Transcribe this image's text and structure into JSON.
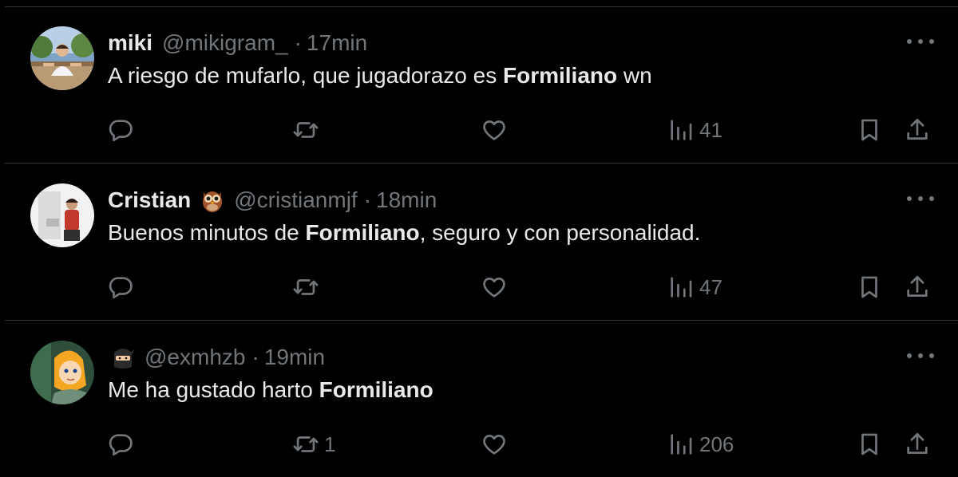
{
  "tweets": [
    {
      "name": "miki",
      "emoji": "",
      "handle": "@mikigram_",
      "separator": "·",
      "time": "17min",
      "text_before": "A riesgo de mufarlo, que jugadorazo es ",
      "text_bold": "Formiliano",
      "text_after": " wn",
      "replies": "",
      "retweets": "",
      "likes": "",
      "views": "41",
      "avatar_icon": "avatar-photo-outdoor"
    },
    {
      "name": "Cristian",
      "emoji": "owl-emoji",
      "handle": "@cristianmjf",
      "separator": "·",
      "time": "18min",
      "text_before": "Buenos minutos de ",
      "text_bold": "Formiliano",
      "text_after": ", seguro y con personalidad.",
      "replies": "",
      "retweets": "",
      "likes": "",
      "views": "47",
      "avatar_icon": "avatar-photo-person"
    },
    {
      "name": "",
      "emoji": "ninja-emoji",
      "handle": "@exmhzb",
      "separator": "·",
      "time": "19min",
      "text_before": "Me ha gustado harto ",
      "text_bold": "Formiliano",
      "text_after": "",
      "replies": "",
      "retweets": "1",
      "likes": "",
      "views": "206",
      "avatar_icon": "avatar-anime-character"
    }
  ],
  "icons": {
    "reply": "reply-icon",
    "retweet": "retweet-icon",
    "like": "heart-icon",
    "views": "views-icon",
    "bookmark": "bookmark-icon",
    "share": "share-icon",
    "more": "more-icon"
  },
  "colors": {
    "background": "#000000",
    "text": "#e7e9ea",
    "muted": "#71767b",
    "divider": "#2f3336"
  }
}
